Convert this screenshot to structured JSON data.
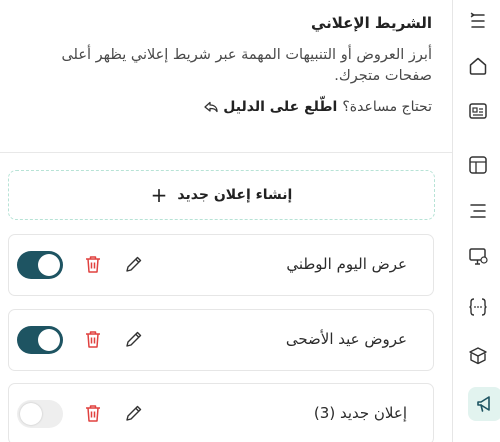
{
  "header": {
    "title": "الشريط الإعلاني",
    "description": "أبرز العروض أو التنبيهات المهمة عبر شريط إعلاني يظهر أعلى صفحات متجرك.",
    "help_prefix": "تحتاج مساعدة؟",
    "help_link": "اطّلع على الدليل"
  },
  "create_button": {
    "label": "إنشاء إعلان جديد",
    "plus": "+"
  },
  "announcements": [
    {
      "label": "عرض اليوم الوطني",
      "enabled": true
    },
    {
      "label": "عروض عيد الأضحى",
      "enabled": true
    },
    {
      "label": "إعلان جديد (3)",
      "enabled": false
    }
  ],
  "sidebar": {
    "icons": [
      "list-icon",
      "home-icon",
      "id-card-icon",
      "layout-icon",
      "menu-icon",
      "monitor-settings-icon",
      "code-braces-icon",
      "box-icon",
      "megaphone-icon"
    ],
    "active": "megaphone-icon"
  },
  "colors": {
    "toggle_on": "#1e5462",
    "accent_light": "#e2f3ef",
    "trash": "#e0413f",
    "dashed_border": "#b7e3d6"
  }
}
